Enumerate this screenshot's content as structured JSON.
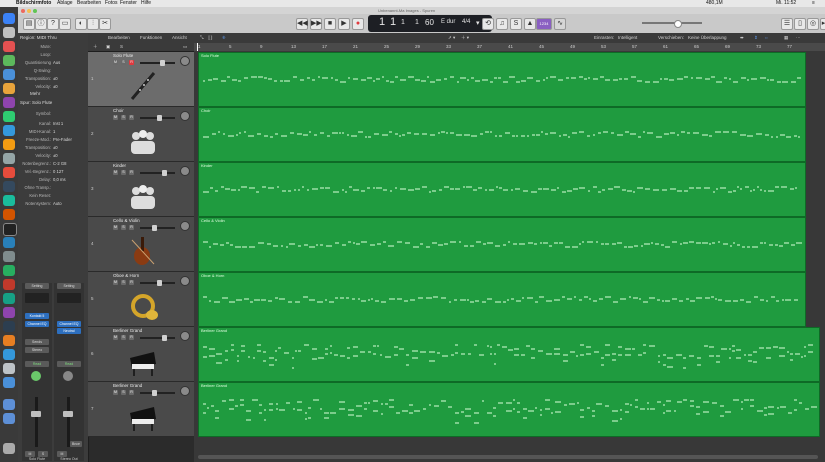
{
  "menubar": {
    "apple": "",
    "app": "Bildschirmfoto",
    "items": [
      "Ablage",
      "Bearbeiten",
      "Fotos",
      "Fenster",
      "Hilfe"
    ],
    "battery": "480,1M",
    "clock": "Mi. 11:52"
  },
  "window": {
    "title": "Unbenannt-Ma Images - Spuren"
  },
  "lcd": {
    "bar": "1",
    "beat": "1",
    "div": "1",
    "tick": "1",
    "tempo": "60",
    "key": "E dur",
    "sig": "4/4"
  },
  "control": {
    "badge": "1234",
    "avatar": "JS"
  },
  "inspector": {
    "region_header": "Region: MIDI Thru",
    "region_rows": [
      {
        "label": "Mute:",
        "value": ""
      },
      {
        "label": "Loop:",
        "value": ""
      },
      {
        "label": "Quantisierung",
        "value": "Aus"
      },
      {
        "label": "Q-Swing:",
        "value": ""
      },
      {
        "label": "Transposition:",
        "value": "±0"
      },
      {
        "label": "Velocity:",
        "value": "±0"
      }
    ],
    "more": "Mehr",
    "track_header": "Spur: Solo Flute",
    "track_rows": [
      {
        "label": "Symbol:",
        "value": ""
      },
      {
        "label": "Kanal:",
        "value": "Inst 1"
      },
      {
        "label": "MIDI-Kanal:",
        "value": "1"
      },
      {
        "label": "Freeze-Mod.:",
        "value": "Pre-Fader"
      },
      {
        "label": "Transposition:",
        "value": "±0"
      },
      {
        "label": "Velocity:",
        "value": "±0"
      },
      {
        "label": "Notenbegrenz.:",
        "value": "C-2  G8"
      },
      {
        "label": "Vel.-Begrenz.:",
        "value": "0  127"
      },
      {
        "label": "Delay:",
        "value": "0,0 ms"
      },
      {
        "label": "Ohne Transp.:",
        "value": ""
      },
      {
        "label": "Kein Reset:",
        "value": ""
      },
      {
        "label": "Notensystem:",
        "value": "Auto"
      }
    ],
    "strip_left": {
      "setting": "Setting",
      "eq": "Channel EQ",
      "sends": "Sends",
      "stereo": "Stereo",
      "read": "Read",
      "name": "Solo Flute",
      "ms_m": "M",
      "ms_s": "S",
      "inst": "Kontakt 5"
    },
    "strip_right": {
      "setting": "Setting",
      "eq": "Channel EQ",
      "neutral": "Neutral",
      "read": "Read",
      "bounce": "Bnce",
      "name": "Stereo Out",
      "ms_m": "M",
      "ms_s": ""
    }
  },
  "edit_menu": {
    "items": [
      "Bearbeiten",
      "Funktionen",
      "Ansicht"
    ],
    "snap_label": "Einrasten:",
    "snap_value": "Intelligent",
    "drag_label": "Verschieben:",
    "drag_value": "Keine Überlappung"
  },
  "ruler": [
    "1",
    "5",
    "9",
    "13",
    "17",
    "21",
    "25",
    "29",
    "33",
    "37",
    "41",
    "45",
    "49",
    "53",
    "57",
    "61",
    "65",
    "69",
    "73",
    "77"
  ],
  "tracks": [
    {
      "num": "1",
      "name": "Solo Flute",
      "region": "Solo Flute",
      "icon": "flute-icon"
    },
    {
      "num": "2",
      "name": "Choir",
      "region": "Choir",
      "icon": "choir-icon"
    },
    {
      "num": "3",
      "name": "Kinder",
      "region": "Kinder",
      "icon": "choir-icon"
    },
    {
      "num": "4",
      "name": "Cello & Violin",
      "region": "Cello & Violin",
      "icon": "violin-icon"
    },
    {
      "num": "5",
      "name": "Oboe & Horn",
      "region": "Oboe & Horn",
      "icon": "horn-icon"
    },
    {
      "num": "6",
      "name": "Berliner Grand",
      "region": "Berliner Grand",
      "icon": "piano-icon"
    },
    {
      "num": "7",
      "name": "Berliner Grand",
      "region": "Berliner Grand",
      "icon": "piano-icon"
    }
  ],
  "colors": {
    "region_green": "#1f9b3f",
    "record_red": "#e0393e",
    "select_blue": "#2d6fbf"
  }
}
